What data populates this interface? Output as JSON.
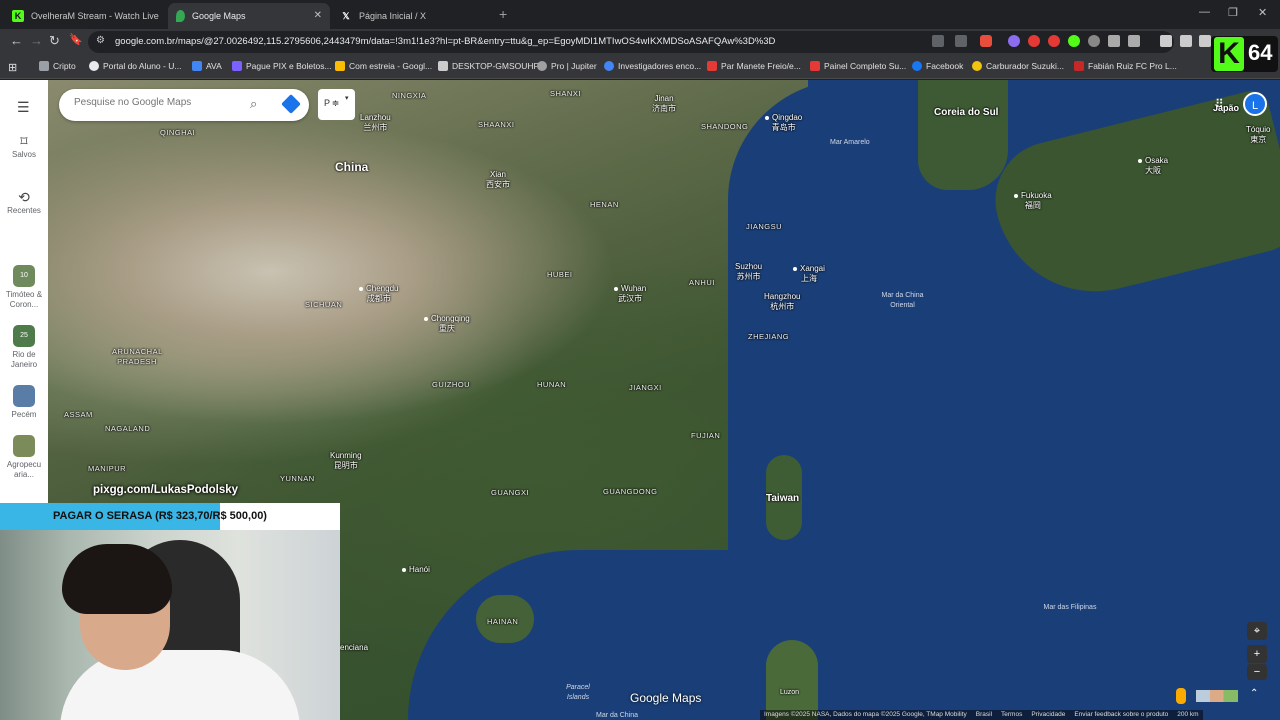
{
  "tabs": [
    {
      "label": "OvelheraM Stream - Watch Live on K",
      "icon": "kick-icon",
      "color": "#53fc18"
    },
    {
      "label": "Google Maps",
      "icon": "google-maps-icon",
      "color": "#34a853"
    },
    {
      "label": "Página Inicial / X",
      "icon": "x-icon",
      "color": "#ffffff"
    }
  ],
  "address": {
    "url": "google.com.br/maps/@27.0026492,115.2795606,2443479m/data=!3m1!1e3?hl=pt-BR&entry=ttu&g_ep=EgoyMDI1MTIwOS4wIKXMDSoASAFQAw%3D%3D"
  },
  "bookmarks": [
    {
      "label": "Cripto",
      "color": "#9aa0a6"
    },
    {
      "label": "Portal do Aluno - U...",
      "color": "#e8eaed"
    },
    {
      "label": "AVA",
      "color": "#4285f4"
    },
    {
      "label": "Pague PIX e Boletos...",
      "color": "#7b61ff"
    },
    {
      "label": "Com estreia - Googl...",
      "color": "#fbbc04"
    },
    {
      "label": "DESKTOP-GMSOUHF",
      "color": "#cccccc"
    },
    {
      "label": "Pro | Jupiter",
      "color": "#a0a0a0"
    },
    {
      "label": "Investigadores enco...",
      "color": "#4285f4"
    },
    {
      "label": "Par Manete Freio/e...",
      "color": "#e53935"
    },
    {
      "label": "Painel Completo Su...",
      "color": "#e53935"
    },
    {
      "label": "Facebook",
      "color": "#1877f2"
    },
    {
      "label": "Carburador Suzuki...",
      "color": "#f1c40f"
    },
    {
      "label": "Fabián Ruiz FC Pro L...",
      "color": "#c62828"
    }
  ],
  "kick": {
    "letter": "K",
    "number": "64"
  },
  "sidebar": {
    "saved": "Salvos",
    "recent": "Recentes",
    "places": [
      {
        "label": "Timóteo & Coron...",
        "badge": "10"
      },
      {
        "label": "Rio de Janeiro",
        "badge": "25"
      },
      {
        "label": "Pecém",
        "badge": ""
      },
      {
        "label": "Agropecu aria...",
        "badge": ""
      }
    ]
  },
  "search": {
    "placeholder": "Pesquise no Google Maps",
    "layer_chip": "P ≑"
  },
  "account": {
    "initial": "L"
  },
  "map": {
    "countries": [
      "China",
      "Coreia do Sul",
      "Japão",
      "Taiwan"
    ],
    "provinces": [
      "NINGXIA",
      "SHANXI",
      "SHAANXI",
      "SHANDONG",
      "QINGHAI",
      "HENAN",
      "JIANGSU",
      "HUBEI",
      "ANHUI",
      "SICHUAN",
      "ZHEJIANG",
      "GUIZHOU",
      "HUNAN",
      "JIANGXI",
      "FUJIAN",
      "YUNNAN",
      "GUANGXI",
      "GUANGDONG",
      "HAINAN",
      "ARUNACHAL PRADESH",
      "ASSAM",
      "NAGALAND",
      "MANIPUR"
    ],
    "cities": [
      {
        "name": "Lanzhou",
        "native": "兰州市"
      },
      {
        "name": "Jinan",
        "native": "济南市"
      },
      {
        "name": "Qingdao",
        "native": "青岛市"
      },
      {
        "name": "Xian",
        "native": "西安市"
      },
      {
        "name": "Suzhou",
        "native": "苏州市"
      },
      {
        "name": "Xangai",
        "native": "上海"
      },
      {
        "name": "Hangzhou",
        "native": "杭州市"
      },
      {
        "name": "Wuhan",
        "native": "武汉市"
      },
      {
        "name": "Chengdu",
        "native": "成都市"
      },
      {
        "name": "Chongqing",
        "native": "重庆"
      },
      {
        "name": "Kunming",
        "native": "昆明市"
      },
      {
        "name": "Hanói",
        "native": ""
      },
      {
        "name": "Fukuoka",
        "native": "福岡"
      },
      {
        "name": "Osaka",
        "native": "大阪"
      },
      {
        "name": "Tóquio",
        "native": "東京"
      },
      {
        "name": "Luzon",
        "native": ""
      },
      {
        "name": "enciana",
        "native": ""
      }
    ],
    "seas": [
      "Mar Amarelo",
      "Mar da China Oriental",
      "Mar das Filipinas",
      "Paracel Islands",
      "Mar da China"
    ],
    "logo": "Google Maps",
    "footer": [
      "Imagens ©2025 NASA, Dados do mapa ©2025 Google, TMap Mobility",
      "Brasil",
      "Termos",
      "Privacidade",
      "Enviar feedback sobre o produto",
      "200 km"
    ]
  },
  "stream": {
    "pix": "pixgg.com/LukasPodolsky",
    "goal_text": "PAGAR O SERASA (R$ 323,70/R$ 500,00)",
    "goal_progress": 0.647
  }
}
